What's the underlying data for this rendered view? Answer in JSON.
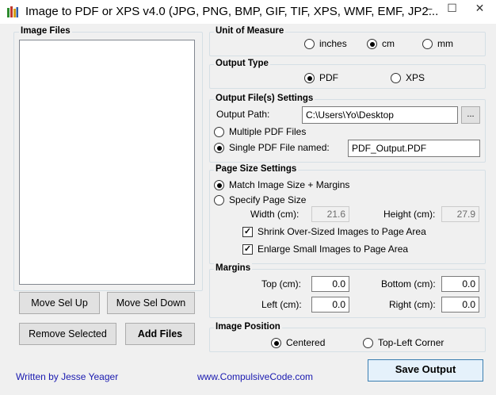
{
  "window": {
    "title": "Image to PDF or XPS  v4.0   (JPG, PNG, BMP, GIF, TIF, XPS, WMF, EMF, JP2...",
    "icon": "books-icon",
    "controls": {
      "minimize": "–",
      "maximize": "☐",
      "close": "✕"
    }
  },
  "image_files": {
    "label": "Image Files",
    "buttons": {
      "move_up": "Move Sel Up",
      "move_down": "Move Sel Down",
      "remove": "Remove Selected",
      "add": "Add Files"
    }
  },
  "unit_of_measure": {
    "label": "Unit of Measure",
    "options": [
      "inches",
      "cm",
      "mm"
    ],
    "selected": "cm"
  },
  "output_type": {
    "label": "Output Type",
    "options": [
      "PDF",
      "XPS"
    ],
    "selected": "PDF"
  },
  "output_files": {
    "label": "Output File(s) Settings",
    "path_label": "Output Path:",
    "path_value": "C:\\Users\\Yo\\Desktop",
    "browse": "...",
    "multiple_label": "Multiple PDF Files",
    "single_label": "Single PDF File named:",
    "single_value": "PDF_Output.PDF",
    "selected": "single"
  },
  "page_size": {
    "label": "Page Size Settings",
    "match_label": "Match Image Size + Margins",
    "specify_label": "Specify Page Size",
    "selected": "match",
    "width_label": "Width (cm):",
    "width_value": "21.6",
    "height_label": "Height (cm):",
    "height_value": "27.9",
    "shrink_label": "Shrink Over-Sized Images to Page Area",
    "shrink_checked": true,
    "enlarge_label": "Enlarge Small Images to Page Area",
    "enlarge_checked": true
  },
  "margins": {
    "label": "Margins",
    "top_label": "Top (cm):",
    "top_value": "0.0",
    "bottom_label": "Bottom (cm):",
    "bottom_value": "0.0",
    "left_label": "Left (cm):",
    "left_value": "0.0",
    "right_label": "Right (cm):",
    "right_value": "0.0"
  },
  "image_position": {
    "label": "Image Position",
    "options": [
      "Centered",
      "Top-Left Corner"
    ],
    "selected": "Centered"
  },
  "footer": {
    "author": "Written by Jesse Yeager",
    "website": "www.CompulsiveCode.com",
    "save": "Save Output"
  },
  "colors": {
    "link": "#1a1ab0",
    "background": "#f0f0f0",
    "group_border": "#d5dfe5"
  }
}
